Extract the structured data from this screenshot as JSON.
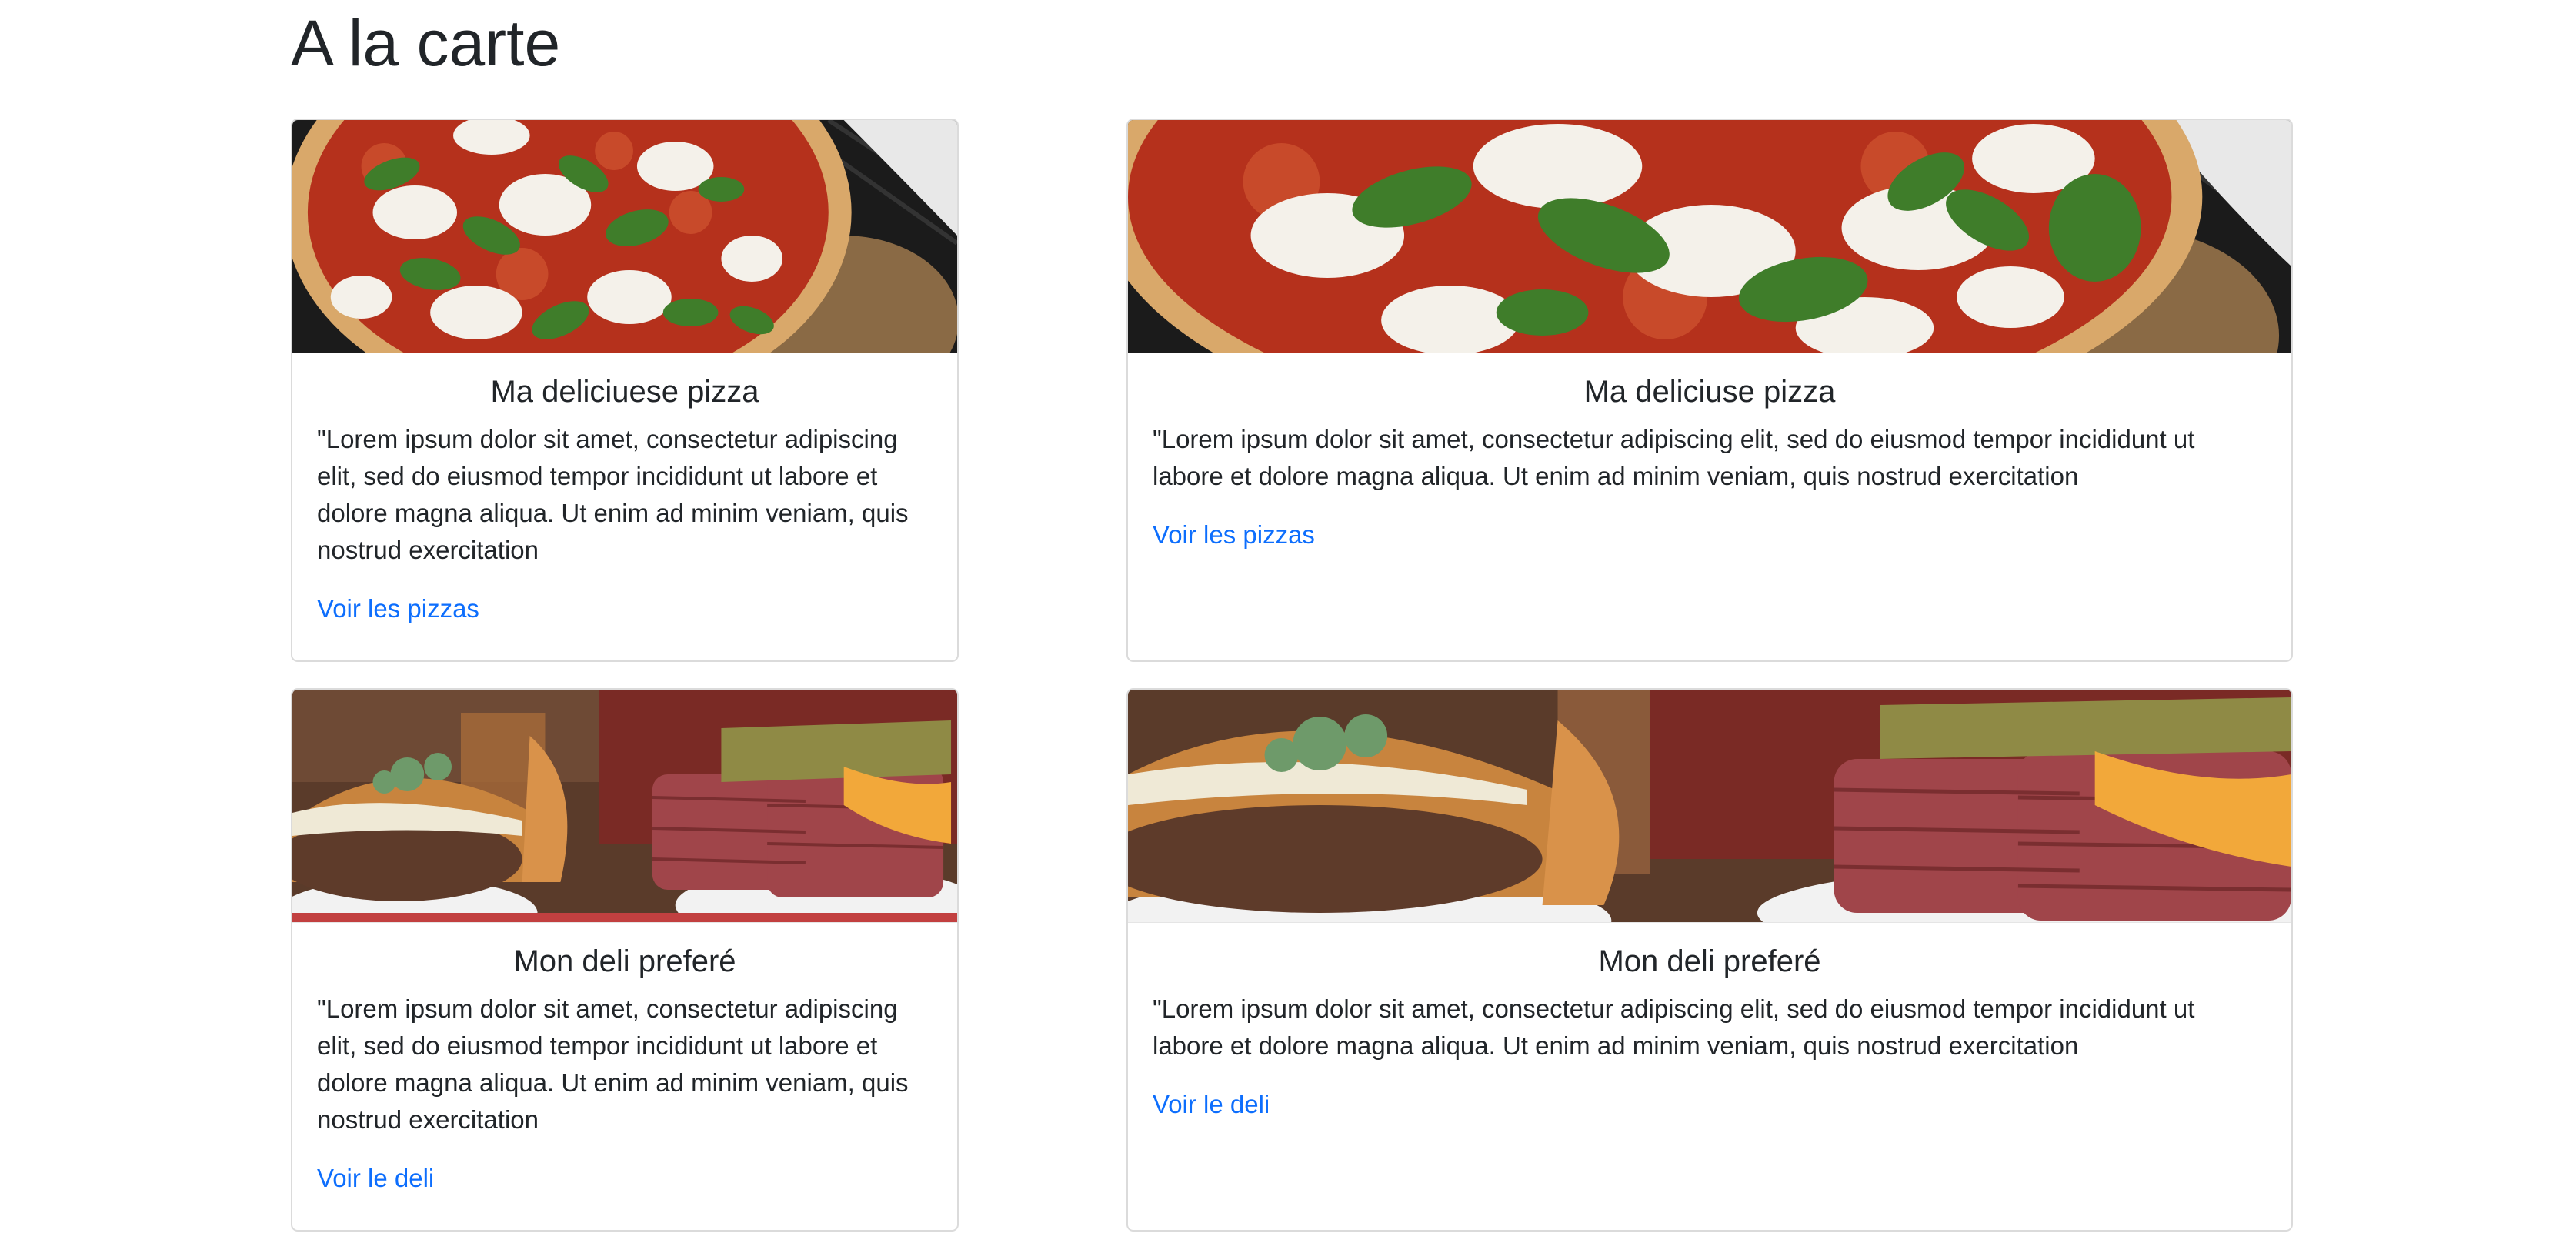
{
  "page": {
    "title": "A la carte"
  },
  "cards": [
    {
      "title": "Ma deliciuese pizza",
      "text": "\"Lorem ipsum dolor sit amet, consectetur adipiscing elit, sed do eiusmod tempor incididunt ut labore et dolore magna aliqua. Ut enim ad minim veniam, quis nostrud exercitation",
      "link": "Voir les pizzas",
      "image": "pizza-photo"
    },
    {
      "title": "Ma deliciuse pizza",
      "text": "\"Lorem ipsum dolor sit amet, consectetur adipiscing elit, sed do eiusmod tempor incididunt ut labore et dolore magna aliqua. Ut enim ad minim veniam, quis nostrud exercitation",
      "link": "Voir les pizzas",
      "image": "pizza-photo"
    },
    {
      "title": "Mon deli preferé",
      "text": "\"Lorem ipsum dolor sit amet, consectetur adipiscing elit, sed do eiusmod tempor incididunt ut labore et dolore magna aliqua. Ut enim ad minim veniam, quis nostrud exercitation",
      "link": "Voir le deli",
      "image": "burger-deli-photo"
    },
    {
      "title": "Mon deli preferé",
      "text": "\"Lorem ipsum dolor sit amet, consectetur adipiscing elit, sed do eiusmod tempor incididunt ut labore et dolore magna aliqua. Ut enim ad minim veniam, quis nostrud exercitation",
      "link": "Voir le deli",
      "image": "burger-deli-photo"
    }
  ],
  "colors": {
    "link": "#0d6efd",
    "text": "#212529",
    "border": "#dee2e6"
  }
}
